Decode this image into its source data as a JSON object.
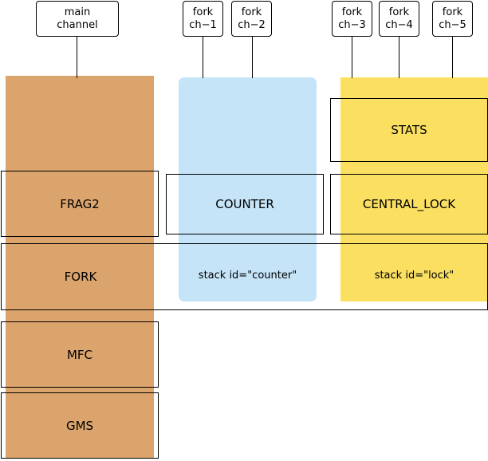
{
  "diagram": {
    "channels": [
      {
        "id": "main-channel",
        "lines": [
          "main",
          "channel"
        ]
      },
      {
        "id": "fork-ch-1",
        "lines": [
          "fork",
          "ch−1"
        ]
      },
      {
        "id": "fork-ch-2",
        "lines": [
          "fork",
          "ch−2"
        ]
      },
      {
        "id": "fork-ch-3",
        "lines": [
          "fork",
          "ch−3"
        ]
      },
      {
        "id": "fork-ch-4",
        "lines": [
          "fork",
          "ch−4"
        ]
      },
      {
        "id": "fork-ch-5",
        "lines": [
          "fork",
          "ch−5"
        ]
      }
    ],
    "columns": [
      {
        "id": "main-column",
        "color": "#dba46c"
      },
      {
        "id": "counter-column",
        "color": "#c5e4f7"
      },
      {
        "id": "lock-column",
        "color": "#fadf60"
      }
    ],
    "modules": [
      {
        "id": "stats",
        "label": "STATS"
      },
      {
        "id": "frag2",
        "label": "FRAG2"
      },
      {
        "id": "counter",
        "label": "COUNTER"
      },
      {
        "id": "central-lock",
        "label": "CENTRAL_LOCK"
      },
      {
        "id": "fork",
        "label": "FORK"
      },
      {
        "id": "mfc",
        "label": "MFC"
      },
      {
        "id": "gms",
        "label": "GMS"
      }
    ],
    "captions": [
      {
        "id": "counter-stack-id",
        "label": "stack id=\"counter\""
      },
      {
        "id": "lock-stack-id",
        "label": "stack id=\"lock\""
      }
    ]
  }
}
